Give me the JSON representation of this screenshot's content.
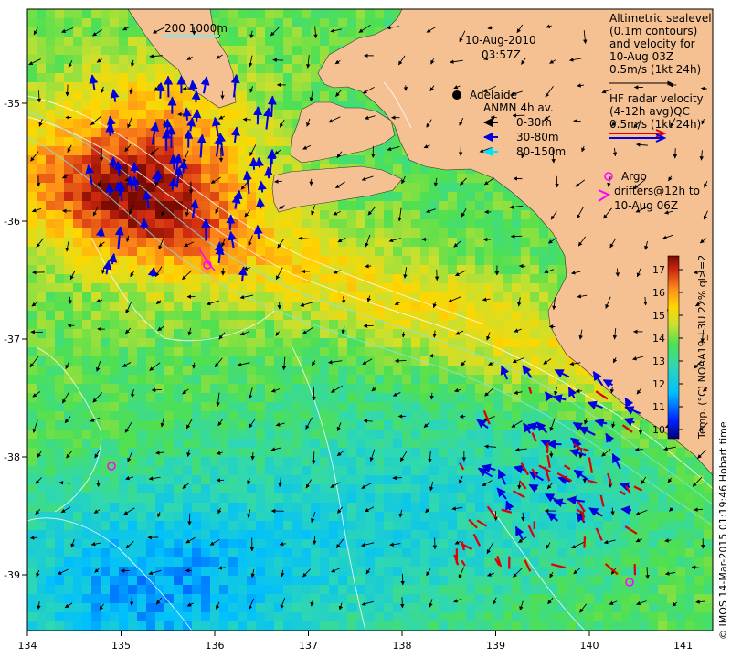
{
  "date": "10-Aug-2010",
  "time": "03:57Z",
  "place": "Adelaide",
  "scale_label": "200 1000m",
  "legend_alt": [
    "Altimetric sealevel",
    "(0.1m contours)",
    "and velocity for",
    "10-Aug 03Z",
    "0.5m/s (1kt 24h)"
  ],
  "legend_hf": [
    "HF radar velocity",
    "(4-12h avg)QC",
    "0.5m/s (1kt 24h)"
  ],
  "legend_anmn": {
    "title": "ANMN 4h av.",
    "items": [
      {
        "label": "0-30m",
        "color": "#000000"
      },
      {
        "label": "30-80m",
        "color": "#0000e0"
      },
      {
        "label": "80-150m",
        "color": "#00e0ff"
      }
    ]
  },
  "legend_argo": [
    "Argo",
    "drifters@12h to",
    "10-Aug 06Z"
  ],
  "colorbar": {
    "title": "Temp. (°C) NOAA19_L3U 22% ql>=2",
    "ticks": [
      "10",
      "11",
      "12",
      "13",
      "14",
      "15",
      "16",
      "17"
    ],
    "min": 9.6,
    "max": 17.6
  },
  "credit": "© IMOS 14-Mar-2015 01:19:46 Hobart time",
  "axes": {
    "x_ticks": [
      "134",
      "135",
      "136",
      "137",
      "138",
      "139",
      "140",
      "141"
    ],
    "y_ticks": [
      "-35",
      "-36",
      "-37",
      "-38",
      "-39"
    ]
  },
  "colors": {
    "land": "#f5c193",
    "ocean_low": "#2b6cd8",
    "ocean_high": "#e8641c",
    "hf_radar": "#e00000",
    "argo": "#ff00ff"
  }
}
